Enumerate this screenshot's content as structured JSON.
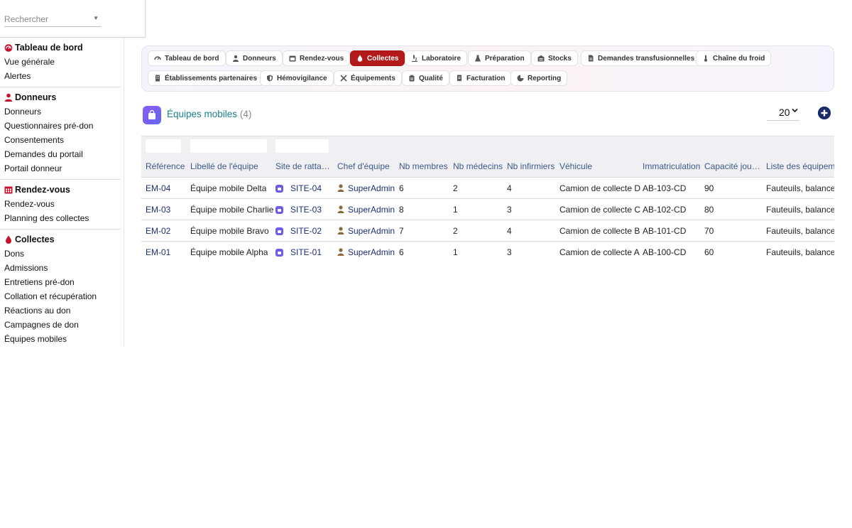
{
  "search": {
    "placeholder": "Rechercher"
  },
  "sidebar": {
    "sections": [
      {
        "title": "Tableau de bord",
        "icon": "dashboard-icon",
        "items": [
          "Vue générale",
          "Alertes"
        ]
      },
      {
        "title": "Donneurs",
        "icon": "user-icon",
        "items": [
          "Donneurs",
          "Questionnaires pré-don",
          "Consentements",
          "Demandes du portail",
          "Portail donneur"
        ]
      },
      {
        "title": "Rendez-vous",
        "icon": "calendar-icon",
        "items": [
          "Rendez-vous",
          "Planning des collectes"
        ]
      },
      {
        "title": "Collectes",
        "icon": "blood-drop-icon",
        "items": [
          "Dons",
          "Admissions",
          "Entretiens pré-don",
          "Collation et récupération",
          "Réactions au don",
          "Campagnes de don",
          "Équipes mobiles"
        ]
      }
    ]
  },
  "tabs": [
    {
      "label": "Tableau de bord",
      "icon": "dashboard-icon"
    },
    {
      "label": "Donneurs",
      "icon": "user-icon"
    },
    {
      "label": "Rendez-vous",
      "icon": "calendar-icon"
    },
    {
      "label": "Collectes",
      "icon": "blood-drop-icon",
      "active": true
    },
    {
      "label": "Laboratoire",
      "icon": "microscope-icon"
    },
    {
      "label": "Préparation",
      "icon": "flask-icon"
    },
    {
      "label": "Stocks",
      "icon": "warehouse-icon"
    },
    {
      "label": "Demandes transfusionnelles",
      "icon": "document-icon"
    },
    {
      "label": "Chaîne du froid",
      "icon": "thermometer-icon"
    },
    {
      "label": "Établissements partenaires",
      "icon": "building-icon"
    },
    {
      "label": "Hémovigilance",
      "icon": "shield-icon"
    },
    {
      "label": "Équipements",
      "icon": "tools-icon"
    },
    {
      "label": "Qualité",
      "icon": "clipboard-icon"
    },
    {
      "label": "Facturation",
      "icon": "invoice-icon"
    },
    {
      "label": "Reporting",
      "icon": "chart-pie-icon"
    }
  ],
  "page": {
    "title": "Équipes mobiles",
    "count": "(4)",
    "page_size": "20"
  },
  "table": {
    "columns": [
      "Référence",
      "Libellé de l'équipe",
      "Site de ratta…",
      "Chef d'équipe",
      "Nb membres",
      "Nb médecins",
      "Nb infirmiers",
      "Véhicule",
      "Immatriculation",
      "Capacité jou…",
      "Liste des équipeme"
    ],
    "rows": [
      [
        "EM-04",
        "Équipe mobile Delta",
        "SITE-04",
        "SuperAdmin",
        "6",
        "2",
        "4",
        "Camion de collecte D",
        "AB-103-CD",
        "90",
        "Fauteuils, balances"
      ],
      [
        "EM-03",
        "Équipe mobile Charlie",
        "SITE-03",
        "SuperAdmin",
        "8",
        "1",
        "3",
        "Camion de collecte C",
        "AB-102-CD",
        "80",
        "Fauteuils, balances"
      ],
      [
        "EM-02",
        "Équipe mobile Bravo",
        "SITE-02",
        "SuperAdmin",
        "7",
        "2",
        "4",
        "Camion de collecte B",
        "AB-101-CD",
        "70",
        "Fauteuils, balances"
      ],
      [
        "EM-01",
        "Équipe mobile Alpha",
        "SITE-01",
        "SuperAdmin",
        "6",
        "1",
        "3",
        "Camion de collecte A",
        "AB-100-CD",
        "60",
        "Fauteuils, balances"
      ]
    ]
  },
  "colors": {
    "accent_red": "#b41a1a",
    "link": "#1c2f73",
    "title_teal": "#1a7f8c",
    "header_blue": "#3b5a8c"
  }
}
